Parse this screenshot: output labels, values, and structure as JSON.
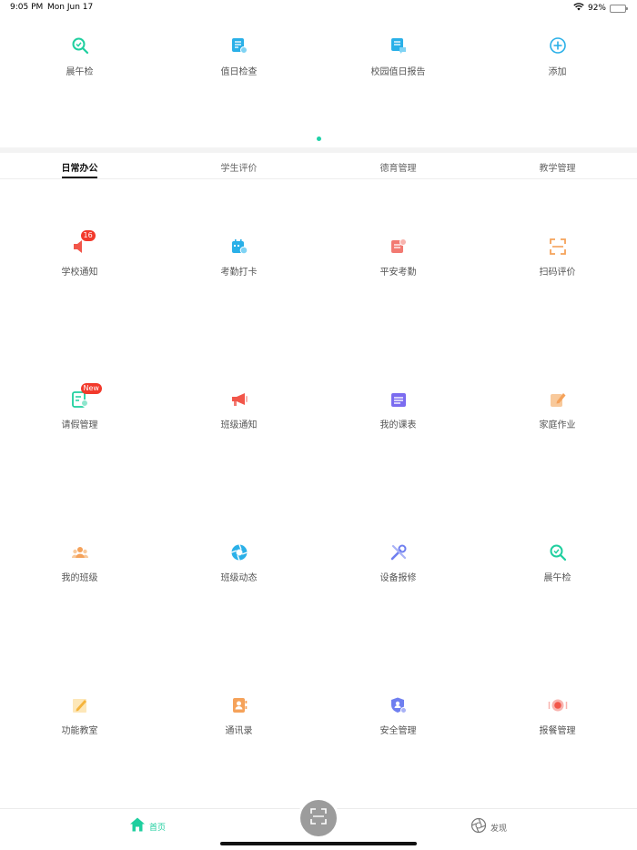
{
  "status_bar": {
    "time": "9:05 PM",
    "date": "Mon Jun 17",
    "battery": "92%",
    "battery_level": 0.92
  },
  "quick_entries": [
    {
      "label": "晨午检",
      "icon": "magnifier-check-icon",
      "color": "#1fcf9f"
    },
    {
      "label": "值日检查",
      "icon": "duty-check-icon",
      "color": "#2ab0e8"
    },
    {
      "label": "校园值日报告",
      "icon": "campus-report-icon",
      "color": "#2ab0e8"
    },
    {
      "label": "添加",
      "icon": "add-circle-icon",
      "color": "#2ab0e8"
    }
  ],
  "tabs": [
    {
      "label": "日常办公",
      "active": true
    },
    {
      "label": "学生评价",
      "active": false
    },
    {
      "label": "德育管理",
      "active": false
    },
    {
      "label": "教学管理",
      "active": false
    }
  ],
  "grid_items": [
    {
      "label": "学校通知",
      "icon": "speaker-icon",
      "color": "#f2564a",
      "badge": "16"
    },
    {
      "label": "考勤打卡",
      "icon": "calendar-clock-icon",
      "color": "#2ab0e8",
      "badge": ""
    },
    {
      "label": "平安考勤",
      "icon": "safety-attendance-icon",
      "color": "#f27a72",
      "badge": ""
    },
    {
      "label": "扫码评价",
      "icon": "scan-frame-icon",
      "color": "#f5a25a",
      "badge": ""
    },
    {
      "label": "请假管理",
      "icon": "leave-doc-icon",
      "color": "#1fcf9f",
      "badge": "New"
    },
    {
      "label": "班级通知",
      "icon": "megaphone-icon",
      "color": "#f2564a",
      "badge": ""
    },
    {
      "label": "我的课表",
      "icon": "timetable-icon",
      "color": "#7b6cf0",
      "badge": ""
    },
    {
      "label": "家庭作业",
      "icon": "homework-edit-icon",
      "color": "#f5a25a",
      "badge": ""
    },
    {
      "label": "我的班级",
      "icon": "people-group-icon",
      "color": "#f5a25a",
      "badge": ""
    },
    {
      "label": "班级动态",
      "icon": "aperture-icon",
      "color": "#2ab0e8",
      "badge": ""
    },
    {
      "label": "设备报修",
      "icon": "tools-icon",
      "color": "#6f7ff0",
      "badge": ""
    },
    {
      "label": "晨午检",
      "icon": "magnifier-check-icon",
      "color": "#1fcf9f",
      "badge": ""
    },
    {
      "label": "功能教室",
      "icon": "pencil-note-icon",
      "color": "#f5b43c",
      "badge": ""
    },
    {
      "label": "通讯录",
      "icon": "contacts-book-icon",
      "color": "#f5a25a",
      "badge": ""
    },
    {
      "label": "安全管理",
      "icon": "shield-user-icon",
      "color": "#6f7ff0",
      "badge": ""
    },
    {
      "label": "报餐管理",
      "icon": "meal-order-icon",
      "color": "#f2564a",
      "badge": ""
    }
  ],
  "bottom_nav": {
    "home_label": "首页",
    "discover_label": "发现",
    "scan_icon": "scan-icon",
    "active_color": "#1fcf9f"
  }
}
